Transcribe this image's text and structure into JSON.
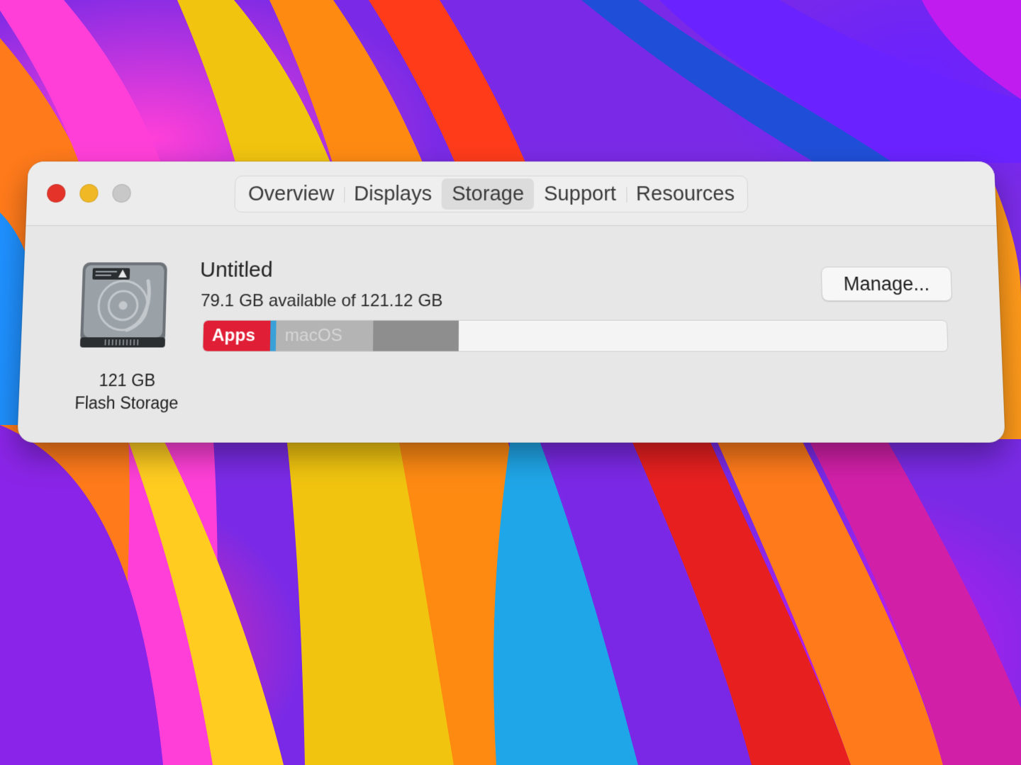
{
  "window": {
    "tabs": [
      {
        "label": "Overview",
        "active": false
      },
      {
        "label": "Displays",
        "active": false
      },
      {
        "label": "Storage",
        "active": true
      },
      {
        "label": "Support",
        "active": false
      },
      {
        "label": "Resources",
        "active": false
      }
    ],
    "traffic_lights": {
      "close_color": "#e4342a",
      "minimize_color": "#f0b824",
      "zoom_color": "#c8c8c8"
    }
  },
  "storage": {
    "disk_icon": "hard-drive-icon",
    "disk_size": "121 GB",
    "disk_type": "Flash Storage",
    "volume_name": "Untitled",
    "available_text": "79.1 GB available of 121.12 GB",
    "manage_label": "Manage...",
    "usage_bar": {
      "segments": [
        {
          "label": "Apps",
          "fraction": 0.09,
          "color": "#e01e35"
        },
        {
          "label": "",
          "fraction": 0.008,
          "color": "#3aa1d8"
        },
        {
          "label": "macOS",
          "fraction": 0.13,
          "color": "#b4b4b4"
        },
        {
          "label": "",
          "fraction": 0.115,
          "color": "#8e8e8e"
        }
      ],
      "free_color": "#f4f4f4"
    }
  }
}
